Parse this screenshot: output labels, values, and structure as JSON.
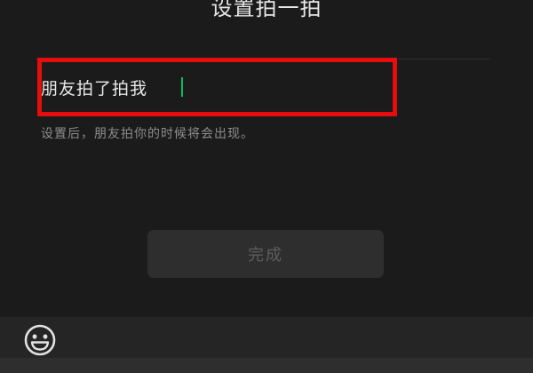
{
  "header": {
    "title": "设置拍一拍"
  },
  "input": {
    "value": "朋友拍了拍我"
  },
  "hint": "设置后，朋友拍你的时候将会出现。",
  "buttons": {
    "done_label": "完成"
  },
  "toolbar": {
    "emoji_icon": "emoji-icon"
  },
  "colors": {
    "caret": "#07c160",
    "highlight": "#e50d0d",
    "background": "#1b1b1b"
  }
}
